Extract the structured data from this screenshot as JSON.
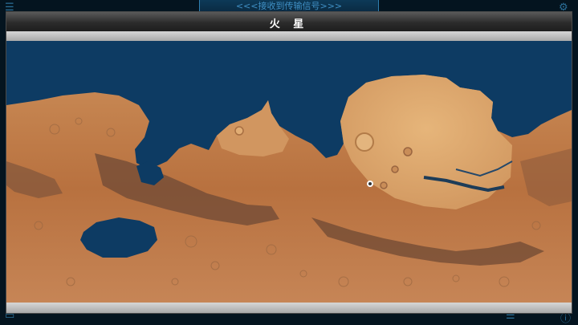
{
  "window": {
    "title": "火 星"
  },
  "background": {
    "banner_text": "<<<接收到传输信号>>>"
  },
  "colors": {
    "ocean": "#0d3b63",
    "land_light": "#d9a066",
    "land_mid": "#c27a48",
    "land_dark": "#6e4a34",
    "frame": "#c4c4c4"
  },
  "icons": {
    "map_marker": "pin-icon"
  }
}
